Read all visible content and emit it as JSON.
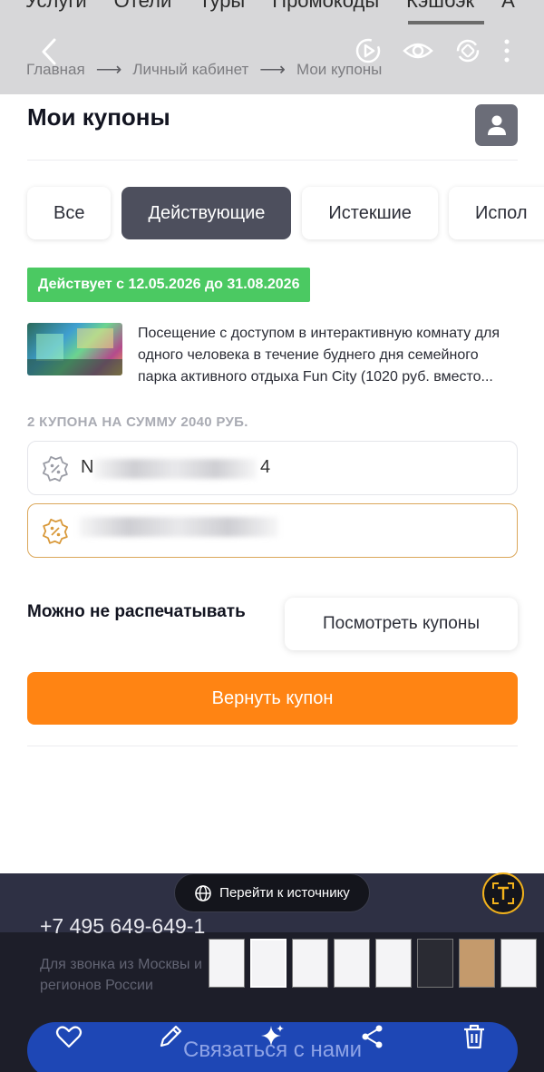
{
  "top_nav": {
    "items": [
      "Услуги",
      "Отели",
      "Туры",
      "Промокоды",
      "Кэшбэк",
      "А"
    ]
  },
  "breadcrumb": {
    "home": "Главная",
    "account": "Личный кабинет",
    "current": "Мои купоны",
    "separator": "⟶"
  },
  "page": {
    "title": "Мои купоны"
  },
  "tabs": [
    {
      "label": "Все",
      "active": false
    },
    {
      "label": "Действующие",
      "active": true
    },
    {
      "label": "Истекшие",
      "active": false
    },
    {
      "label": "Испол",
      "active": false
    }
  ],
  "coupon": {
    "validity": "Действует с 12.05.2026 до 31.08.2026",
    "description": "Посещение с доступом в интерактивную комнату для одного человека в течение буднего дня семейного парка активного отдыха Fun City (1020 руб. вместо...",
    "summary": "2 КУПОНА НА СУММУ 2040 РУБ.",
    "codes": [
      {
        "visible_start": "N",
        "visible_end": "4"
      },
      {
        "visible_start": "",
        "visible_end": ""
      }
    ],
    "print_note": "Можно не распечатывать",
    "view_button": "Посмотреть купоны",
    "return_button": "Вернуть купон"
  },
  "footer": {
    "phone": "+7 495 649-649-1",
    "phone_note": "Для звонка из Москвы и регионов России",
    "contact_button": "Связаться с нами",
    "source_button": "Перейти к источнику"
  },
  "colors": {
    "active_tab": "#4d4f5d",
    "validity_badge": "#4bc962",
    "return_button": "#ff8413",
    "contact_button": "#1e47b5"
  }
}
